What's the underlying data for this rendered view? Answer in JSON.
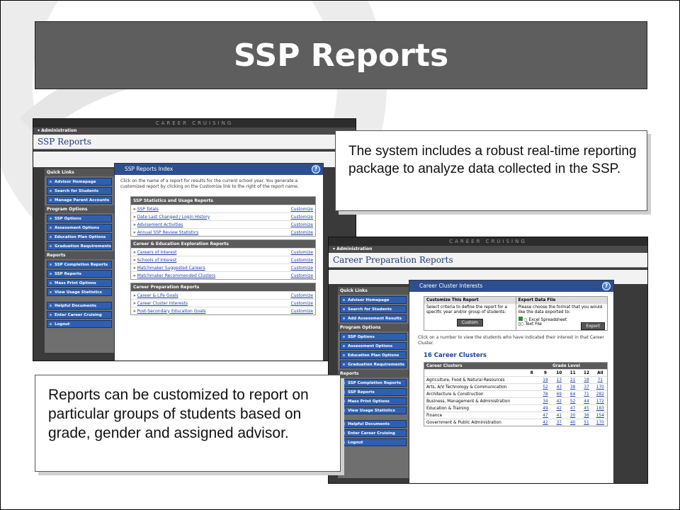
{
  "slide": {
    "title": "SSP Reports"
  },
  "callouts": {
    "top": "The system includes a robust real-time reporting package to analyze data collected in the SSP.",
    "bottom": "Reports can be customized to report on particular groups of students based on grade, gender and assigned advisor."
  },
  "shot1": {
    "brand": "CAREER CRUISING",
    "breadcrumb": "Administration",
    "page_title": "SSP Reports",
    "nav": [
      {
        "section": "Quick Links",
        "items": [
          "Advisor Homepage",
          "Search for Students",
          "Manage Parent Accounts"
        ]
      },
      {
        "section": "Program Options",
        "items": [
          "SSP Options",
          "Assessment Options",
          "Education Plan Options",
          "Graduation Requirements"
        ]
      },
      {
        "section": "Reports",
        "items": [
          "SSP Completion Reports",
          "SSP Reports",
          "Mass Print Options",
          "View Usage Statistics"
        ]
      },
      {
        "section": "",
        "items": [
          "Helpful Documents",
          "Enter Career Cruising",
          "Logout"
        ]
      }
    ],
    "popup": {
      "title": "SSP Reports Index",
      "help": "?",
      "intro": "Click on the name of a report for results for the current school year. You generate a customized report by clicking on the Customize link to the right of the report name.",
      "customize_label": "Customize",
      "sections": [
        {
          "title": "SSP Statistics and Usage Reports",
          "rows": [
            "SSP Totals",
            "Date Last Changed / Login History",
            "Advisement Activities",
            "Annual SSP Review Statistics"
          ]
        },
        {
          "title": "Career & Education Exploration Reports",
          "rows": [
            "Careers of Interest",
            "Schools of Interest",
            "Matchmaker Suggested Careers",
            "Matchmaker Recommended Clusters"
          ]
        },
        {
          "title": "Career Preparation Reports",
          "rows": [
            "Career & Life Goals",
            "Career Cluster Interests",
            "Post-Secondary Education Goals"
          ]
        }
      ]
    }
  },
  "shot2": {
    "brand": "CAREER CRUISING",
    "breadcrumb": "Administration",
    "page_title": "Career Preparation Reports",
    "nav": [
      {
        "section": "Quick Links",
        "items": [
          "Advisor Homepage",
          "Search for Students",
          "Add Assessment Results"
        ]
      },
      {
        "section": "Program Options",
        "items": [
          "SSP Options",
          "Assessment Options",
          "Education Plan Options",
          "Graduation Requirements"
        ]
      },
      {
        "section": "Reports",
        "items": [
          "SSP Completion Reports",
          "SSP Reports",
          "Mass Print Options",
          "View Usage Statistics"
        ]
      },
      {
        "section": "",
        "items": [
          "Helpful Documents",
          "Enter Career Cruising",
          "Logout"
        ]
      }
    ],
    "popup": {
      "title": "Career Cluster Interests",
      "help": "?",
      "customize_title": "Customize This Report",
      "customize_text": "Select criteria to define the report for a specific year and/or group of students:",
      "custom_button": "Custom",
      "export_title": "Export Data File",
      "export_text": "Please choose the format that you would like the data exported to:",
      "export_options": [
        "Excel Spreadsheet",
        "Text File"
      ],
      "export_button": "Export",
      "instructions": "Click on a number to view the students who have indicated their interest in that Career Cluster.",
      "count_heading": "16 Career Clusters",
      "table": {
        "col_header": "Career Clusters",
        "group_header": "Grade Level",
        "grades": [
          "8",
          "9",
          "10",
          "11",
          "12",
          "All"
        ],
        "rows": [
          {
            "name": "Agriculture, Food & Natural Resources",
            "values": [
              "",
              "19",
              "13",
              "21",
              "18",
              "71"
            ]
          },
          {
            "name": "Arts, A/V Technology & Communication",
            "values": [
              "",
              "52",
              "43",
              "38",
              "37",
              "170"
            ]
          },
          {
            "name": "Architecture & Construction",
            "values": [
              "",
              "78",
              "69",
              "64",
              "71",
              "282"
            ]
          },
          {
            "name": "Business, Management & Administration",
            "values": [
              "",
              "34",
              "42",
              "52",
              "44",
              "172"
            ]
          },
          {
            "name": "Education & Training",
            "values": [
              "",
              "49",
              "42",
              "47",
              "45",
              "183"
            ]
          },
          {
            "name": "Finance",
            "values": [
              "",
              "47",
              "41",
              "30",
              "36",
              "154"
            ]
          },
          {
            "name": "Government & Public Administration",
            "values": [
              "",
              "42",
              "37",
              "40",
              "51",
              "170"
            ]
          }
        ]
      }
    }
  }
}
